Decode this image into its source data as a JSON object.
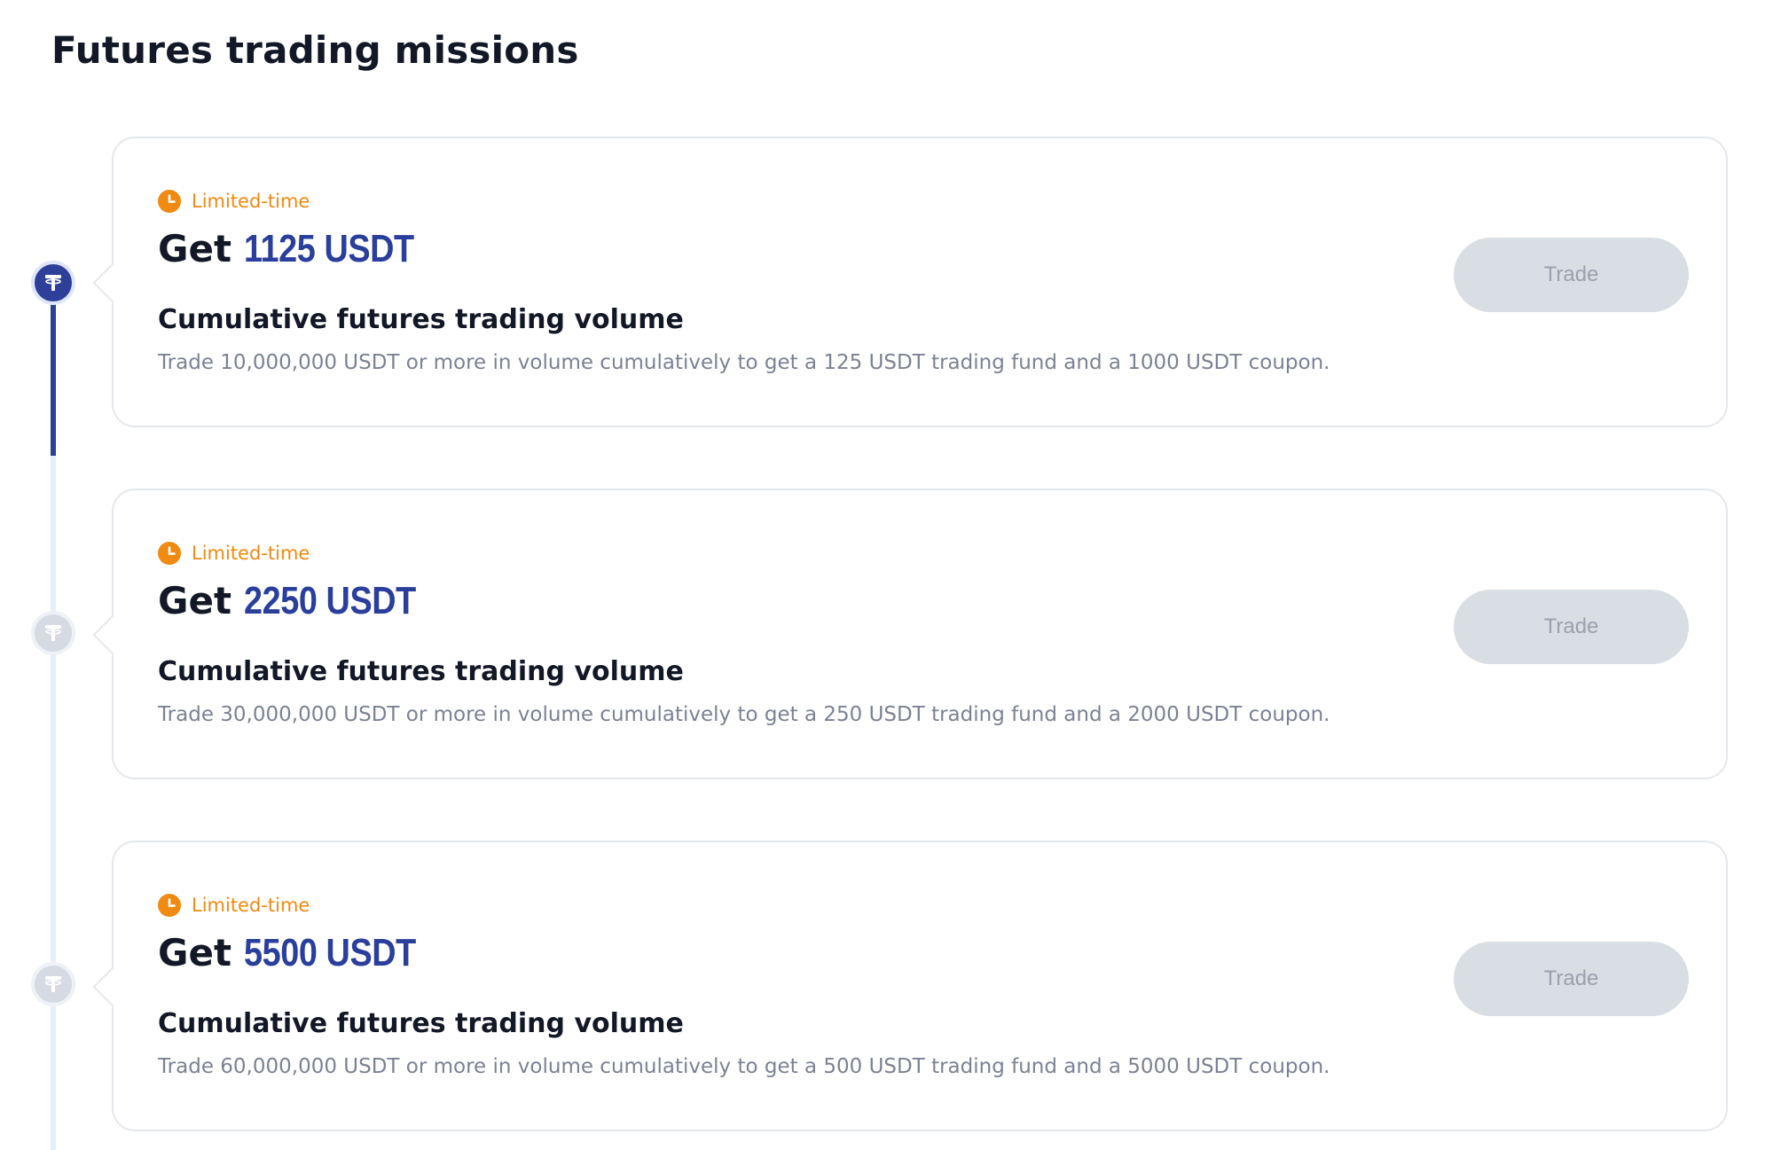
{
  "page": {
    "title": "Futures trading missions"
  },
  "colors": {
    "accent": "#2a3f9c",
    "tag": "#f08a12",
    "muted_text": "#7b8293",
    "button_disabled_bg": "#d9dde4",
    "button_disabled_text": "#9aa1ad"
  },
  "missions": [
    {
      "status": "active",
      "icon": "tether-icon",
      "tag_icon": "clock-icon",
      "tag": "Limited-time",
      "reward_prefix": "Get",
      "reward_amount": "1125 USDT",
      "title": "Cumulative futures trading volume",
      "description": "Trade 10,000,000 USDT or more in volume cumulatively to get a 125 USDT trading fund and a 1000 USDT coupon.",
      "button_label": "Trade"
    },
    {
      "status": "inactive",
      "icon": "tether-icon",
      "tag_icon": "clock-icon",
      "tag": "Limited-time",
      "reward_prefix": "Get",
      "reward_amount": "2250 USDT",
      "title": "Cumulative futures trading volume",
      "description": "Trade 30,000,000 USDT or more in volume cumulatively to get a 250 USDT trading fund and a 2000 USDT coupon.",
      "button_label": "Trade"
    },
    {
      "status": "inactive",
      "icon": "tether-icon",
      "tag_icon": "clock-icon",
      "tag": "Limited-time",
      "reward_prefix": "Get",
      "reward_amount": "5500 USDT",
      "title": "Cumulative futures trading volume",
      "description": "Trade 60,000,000 USDT or more in volume cumulatively to get a 500 USDT trading fund and a 5000 USDT coupon.",
      "button_label": "Trade"
    }
  ]
}
